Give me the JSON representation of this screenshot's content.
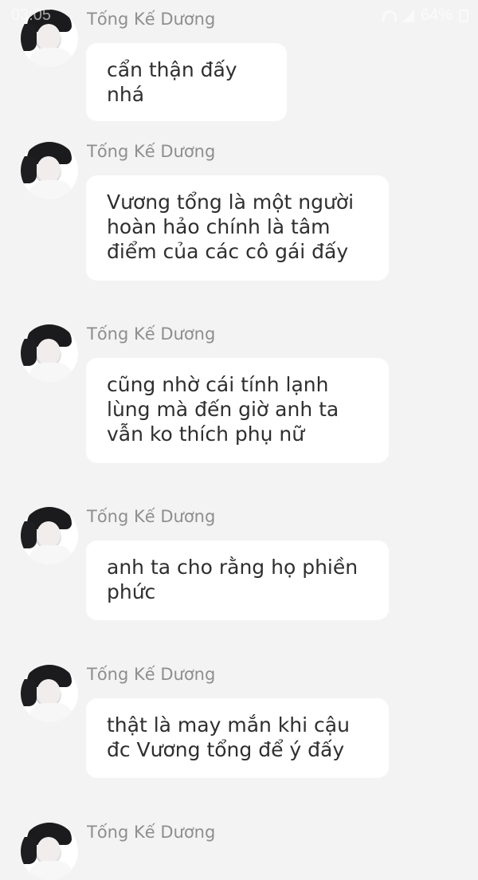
{
  "status_bar": {
    "time": "03:05",
    "battery": "64%"
  },
  "messages": [
    {
      "name": "Tống Kế Dương",
      "text": "cẩn thận đấy nhá"
    },
    {
      "name": "Tống Kế Dương",
      "text": "Vương tổng là một người hoàn hảo chính là tâm điểm của các cô gái đấy"
    },
    {
      "name": "Tống Kế Dương",
      "text": "cũng nhờ cái tính lạnh lùng mà đến giờ anh ta vẫn ko thích phụ nữ"
    },
    {
      "name": "Tống Kế Dương",
      "text": "anh ta cho rằng họ phiền phức"
    },
    {
      "name": "Tống Kế Dương",
      "text": "thật là may mắn khi cậu đc Vương tổng để ý đấy"
    },
    {
      "name": "Tống Kế Dương",
      "text": ""
    }
  ]
}
